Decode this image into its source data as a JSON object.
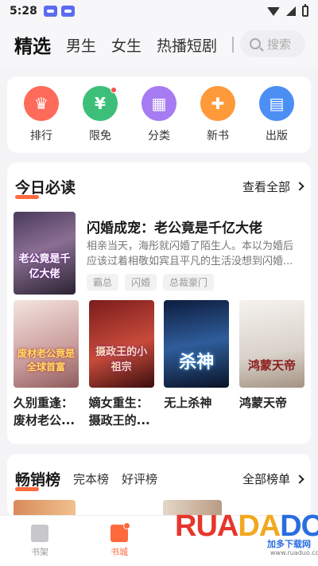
{
  "status_bar": {
    "time": "5:28"
  },
  "top_nav": {
    "tabs": [
      "精选",
      "男生",
      "女生",
      "热播短剧"
    ],
    "search_placeholder": "搜索"
  },
  "categories": [
    {
      "label": "排行",
      "icon": "trophy-icon",
      "color": "#ff6b5a"
    },
    {
      "label": "限免",
      "icon": "discount-tag-icon",
      "color": "#3dbf7a"
    },
    {
      "label": "分类",
      "icon": "grid-icon",
      "color": "#a77cf2"
    },
    {
      "label": "新书",
      "icon": "thumbs-up-icon",
      "color": "#ff9a3a"
    },
    {
      "label": "出版",
      "icon": "book-icon",
      "color": "#4b8ff5"
    }
  ],
  "today": {
    "title": "今日必读",
    "view_all": "查看全部",
    "feature": {
      "title": "闪婚成宠：老公竟是千亿大佬",
      "desc": "相亲当天，海彤就闪婚了陌生人。本以为婚后应该过着相敬如宾且平凡的生活没想到闪婚...",
      "tags": [
        "霸总",
        "闪婚",
        "总裁豪门"
      ],
      "cover_text": "老公竟是千亿大佬",
      "cover_color": "#7d5f8a"
    },
    "books": [
      {
        "title": "久别重逢：废材老公...",
        "cover_text": "废材老公竟是全球首富",
        "cover_color": "#e9d6d2"
      },
      {
        "title": "嫡女重生：摄政王的...",
        "cover_text": "摄政王的小祖宗",
        "cover_color": "#b53a3a"
      },
      {
        "title": "无上杀神",
        "cover_text": "杀神",
        "cover_color": "#1f3a6b"
      },
      {
        "title": "鸿蒙天帝",
        "cover_text": "鸿蒙天帝",
        "cover_color": "#e7e4e0"
      }
    ]
  },
  "bestsellers": {
    "title": "畅销榜",
    "tabs": [
      "完本榜",
      "好评榜"
    ],
    "all_label": "全部榜单"
  },
  "bottom_nav": [
    {
      "label": "书架",
      "active": false
    },
    {
      "label": "书城",
      "active": true
    }
  ],
  "watermark": {
    "logo": "RUADADO",
    "sub1": "加多下载网",
    "sub2": "www.ruaduo.com"
  }
}
